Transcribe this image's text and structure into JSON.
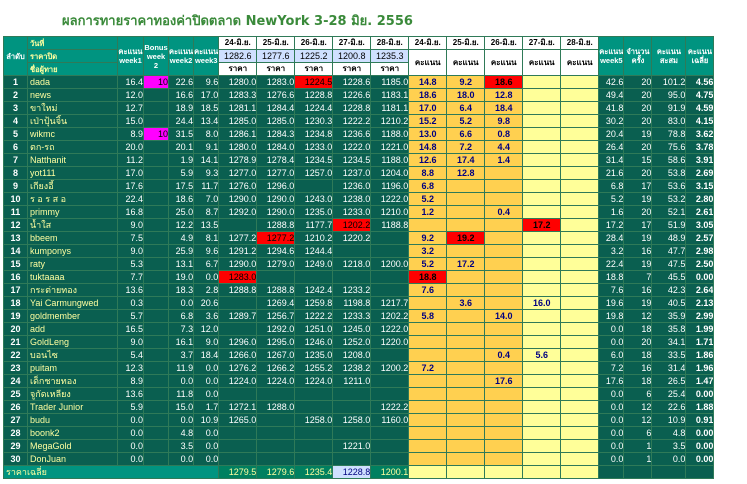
{
  "title": "ผลการทายราคาทองค่าปิดตลาด NewYork 3-28 มิย. 2556",
  "headers": {
    "rank": "ลำดับ",
    "date_label": "วันที่",
    "close_label": "ราคาปิด",
    "name_label": "ชื่อผู้ทาย",
    "week1": "คะแนน week1",
    "bonus": "Bonus week 2",
    "week2": "คะแนน week2",
    "week3": "คะแนน week3",
    "week5": "คะแนน week5",
    "total": "คะแนน สะสม",
    "count": "จำนวน ครั้ง",
    "avg": "คะแนน เฉลี่ย",
    "last": "คะแนน เฉลี่ย",
    "price_word": "ราคา",
    "score_word": "คะแนน",
    "average_label": "ราคาเฉลี่ย"
  },
  "dates": [
    "24-มิ.ย.",
    "25-มิ.ย.",
    "26-มิ.ย.",
    "27-มิ.ย.",
    "28-มิ.ย."
  ],
  "close_prices": [
    "1282.6",
    "1277.6",
    "1225.2",
    "1200.8",
    "1235.3"
  ],
  "average_prices": [
    "1279.5",
    "1279.6",
    "1235.4",
    "1228.8",
    "1200.1"
  ],
  "rows": [
    {
      "no": "1",
      "name": "dada",
      "w1": "16.4",
      "bonus": "10",
      "w2": "22.6",
      "w3": "9.6",
      "p": [
        "1280.0",
        "1283.0",
        "1224.5",
        "1228.6",
        "1185.0"
      ],
      "s": [
        "14.8",
        "9.2",
        "18.6",
        "",
        ""
      ],
      "w5": "42.6",
      "cnt": "20",
      "tot": "101.2",
      "avg": "4.56"
    },
    {
      "no": "2",
      "name": "news",
      "w1": "12.0",
      "bonus": "",
      "w2": "16.6",
      "w3": "17.0",
      "p": [
        "1283.3",
        "1276.6",
        "1228.8",
        "1226.6",
        "1183.1"
      ],
      "s": [
        "18.6",
        "18.0",
        "12.8",
        "",
        ""
      ],
      "w5": "49.4",
      "cnt": "20",
      "tot": "95.0",
      "avg": "4.75"
    },
    {
      "no": "3",
      "name": "ขาใหม่",
      "w1": "12.7",
      "bonus": "",
      "w2": "18.9",
      "w3": "18.5",
      "p": [
        "1281.1",
        "1284.4",
        "1224.4",
        "1228.8",
        "1181.1"
      ],
      "s": [
        "17.0",
        "6.4",
        "18.4",
        "",
        ""
      ],
      "w5": "41.8",
      "cnt": "20",
      "tot": "91.9",
      "avg": "4.59"
    },
    {
      "no": "4",
      "name": "เป่าปุ้นจิ้น",
      "w1": "15.0",
      "bonus": "",
      "w2": "24.4",
      "w3": "13.4",
      "p": [
        "1285.0",
        "1285.0",
        "1230.3",
        "1222.2",
        "1210.2"
      ],
      "s": [
        "15.2",
        "5.2",
        "9.8",
        "",
        ""
      ],
      "w5": "30.2",
      "cnt": "20",
      "tot": "83.0",
      "avg": "4.15"
    },
    {
      "no": "5",
      "name": "wikmc",
      "w1": "8.9",
      "bonus": "10",
      "w2": "31.5",
      "w3": "8.0",
      "p": [
        "1286.1",
        "1284.3",
        "1234.8",
        "1236.6",
        "1188.0"
      ],
      "s": [
        "13.0",
        "6.6",
        "0.8",
        "",
        ""
      ],
      "w5": "20.4",
      "cnt": "19",
      "tot": "78.8",
      "avg": "3.62"
    },
    {
      "no": "6",
      "name": "ตก-รถ",
      "w1": "20.0",
      "bonus": "",
      "w2": "20.1",
      "w3": "9.1",
      "p": [
        "1280.0",
        "1284.0",
        "1233.0",
        "1222.0",
        "1221.0"
      ],
      "s": [
        "14.8",
        "7.2",
        "4.4",
        "",
        ""
      ],
      "w5": "26.4",
      "cnt": "20",
      "tot": "75.6",
      "avg": "3.78"
    },
    {
      "no": "7",
      "name": "Natthanit",
      "w1": "11.2",
      "bonus": "",
      "w2": "1.9",
      "w3": "14.1",
      "p": [
        "1278.9",
        "1278.4",
        "1234.5",
        "1234.5",
        "1188.0"
      ],
      "s": [
        "12.6",
        "17.4",
        "1.4",
        "",
        ""
      ],
      "w5": "31.4",
      "cnt": "15",
      "tot": "58.6",
      "avg": "3.91"
    },
    {
      "no": "8",
      "name": "yot111",
      "w1": "17.0",
      "bonus": "",
      "w2": "5.9",
      "w3": "9.3",
      "p": [
        "1277.0",
        "1277.0",
        "1257.0",
        "1237.0",
        "1204.0"
      ],
      "s": [
        "8.8",
        "12.8",
        "",
        "",
        ""
      ],
      "w5": "21.6",
      "cnt": "20",
      "tot": "53.8",
      "avg": "2.69"
    },
    {
      "no": "9",
      "name": "เกียงอี้",
      "w1": "17.6",
      "bonus": "",
      "w2": "17.5",
      "w3": "11.7",
      "p": [
        "1276.0",
        "1296.0",
        "",
        "1236.0",
        "1196.0"
      ],
      "s": [
        "6.8",
        "",
        "",
        "",
        ""
      ],
      "w5": "6.8",
      "cnt": "17",
      "tot": "53.6",
      "avg": "3.15"
    },
    {
      "no": "10",
      "name": "ร อ ร ส อ",
      "w1": "22.4",
      "bonus": "",
      "w2": "18.6",
      "w3": "7.0",
      "p": [
        "1290.0",
        "1290.0",
        "1243.0",
        "1238.0",
        "1222.0"
      ],
      "s": [
        "5.2",
        "",
        "",
        "",
        ""
      ],
      "w5": "5.2",
      "cnt": "19",
      "tot": "53.2",
      "avg": "2.80"
    },
    {
      "no": "11",
      "name": "primmy",
      "w1": "16.8",
      "bonus": "",
      "w2": "25.0",
      "w3": "8.7",
      "p": [
        "1292.0",
        "1290.0",
        "1235.0",
        "1233.0",
        "1210.0"
      ],
      "s": [
        "1.2",
        "",
        "0.4",
        "",
        ""
      ],
      "w5": "1.6",
      "cnt": "20",
      "tot": "52.1",
      "avg": "2.61"
    },
    {
      "no": "12",
      "name": "น้ำใส",
      "w1": "9.0",
      "bonus": "",
      "w2": "12.2",
      "w3": "13.5",
      "p": [
        "",
        "1288.8",
        "1177.7",
        "1202.2",
        "1188.8"
      ],
      "s": [
        "",
        "",
        "",
        "17.2",
        ""
      ],
      "w5": "17.2",
      "cnt": "17",
      "tot": "51.9",
      "avg": "3.05"
    },
    {
      "no": "13",
      "name": "bbeem",
      "w1": "7.5",
      "bonus": "",
      "w2": "4.9",
      "w3": "8.1",
      "p": [
        "1277.2",
        "1277.2",
        "1210.2",
        "1220.2",
        ""
      ],
      "s": [
        "9.2",
        "19.2",
        "",
        "",
        ""
      ],
      "w5": "28.4",
      "cnt": "19",
      "tot": "48.9",
      "avg": "2.57"
    },
    {
      "no": "14",
      "name": "kumponys",
      "w1": "9.0",
      "bonus": "",
      "w2": "25.9",
      "w3": "9.6",
      "p": [
        "1291.2",
        "1294.6",
        "1244.4",
        "",
        "",
        ""
      ],
      "s": [
        "3.2",
        "",
        "",
        "",
        ""
      ],
      "w5": "3.2",
      "cnt": "16",
      "tot": "47.7",
      "avg": "2.98"
    },
    {
      "no": "15",
      "name": "raty",
      "w1": "5.3",
      "bonus": "",
      "w2": "13.1",
      "w3": "6.7",
      "p": [
        "1290.0",
        "1279.0",
        "1249.0",
        "1218.0",
        "1200.0"
      ],
      "s": [
        "5.2",
        "17.2",
        "",
        "",
        ""
      ],
      "w5": "22.4",
      "cnt": "19",
      "tot": "47.5",
      "avg": "2.50"
    },
    {
      "no": "16",
      "name": "tuktaaaa",
      "w1": "7.7",
      "bonus": "",
      "w2": "19.0",
      "w3": "0.0",
      "p": [
        "1283.0",
        "",
        "",
        "",
        "",
        ""
      ],
      "s": [
        "18.8",
        "",
        "",
        "",
        ""
      ],
      "w5": "18.8",
      "cnt": "7",
      "tot": "45.5",
      "avg": "0.00"
    },
    {
      "no": "17",
      "name": "กระต่ายทอง",
      "w1": "13.6",
      "bonus": "",
      "w2": "18.3",
      "w3": "2.8",
      "p": [
        "1288.8",
        "1288.8",
        "1242.4",
        "1233.2",
        ""
      ],
      "s": [
        "7.6",
        "",
        "",
        "",
        ""
      ],
      "w5": "7.6",
      "cnt": "16",
      "tot": "42.3",
      "avg": "2.64"
    },
    {
      "no": "18",
      "name": "Yai Carmungwed",
      "w1": "0.3",
      "bonus": "",
      "w2": "0.0",
      "w3": "20.6",
      "p": [
        "",
        "1269.4",
        "1259.8",
        "1198.8",
        "1217.7"
      ],
      "s": [
        "",
        "3.6",
        "",
        "16.0",
        ""
      ],
      "w5": "19.6",
      "cnt": "19",
      "tot": "40.5",
      "avg": "2.13"
    },
    {
      "no": "19",
      "name": "goldmember",
      "w1": "5.7",
      "bonus": "",
      "w2": "6.8",
      "w3": "3.6",
      "p": [
        "1289.7",
        "1256.7",
        "1222.2",
        "1233.3",
        "1202.2"
      ],
      "s": [
        "5.8",
        "",
        "14.0",
        "",
        ""
      ],
      "w5": "19.8",
      "cnt": "12",
      "tot": "35.9",
      "avg": "2.99"
    },
    {
      "no": "20",
      "name": "add",
      "w1": "16.5",
      "bonus": "",
      "w2": "7.3",
      "w3": "12.0",
      "p": [
        "",
        "1292.0",
        "1251.0",
        "1245.0",
        "1222.0"
      ],
      "s": [
        "",
        "",
        "",
        "",
        ""
      ],
      "w5": "0.0",
      "cnt": "18",
      "tot": "35.8",
      "avg": "1.99"
    },
    {
      "no": "21",
      "name": "GoldLeng",
      "w1": "9.0",
      "bonus": "",
      "w2": "16.1",
      "w3": "9.0",
      "p": [
        "1296.0",
        "1295.0",
        "1246.0",
        "1252.0",
        "1220.0"
      ],
      "s": [
        "",
        "",
        "",
        "",
        ""
      ],
      "w5": "0.0",
      "cnt": "20",
      "tot": "34.1",
      "avg": "1.71"
    },
    {
      "no": "22",
      "name": "บอนไซ",
      "w1": "5.4",
      "bonus": "",
      "w2": "3.7",
      "w3": "18.4",
      "p": [
        "1266.0",
        "1267.0",
        "1235.0",
        "1208.0",
        ""
      ],
      "s": [
        "",
        "",
        "0.4",
        "5.6",
        ""
      ],
      "w5": "6.0",
      "cnt": "18",
      "tot": "33.5",
      "avg": "1.86"
    },
    {
      "no": "23",
      "name": "puitam",
      "w1": "12.3",
      "bonus": "",
      "w2": "11.9",
      "w3": "0.0",
      "p": [
        "1276.2",
        "1266.2",
        "1255.2",
        "1238.2",
        "1200.2"
      ],
      "s": [
        "7.2",
        "",
        "",
        "",
        ""
      ],
      "w5": "7.2",
      "cnt": "16",
      "tot": "31.4",
      "avg": "1.96"
    },
    {
      "no": "24",
      "name": "เด็กชายทอง",
      "w1": "8.9",
      "bonus": "",
      "w2": "0.0",
      "w3": "0.0",
      "p": [
        "1224.0",
        "1224.0",
        "1224.0",
        "1211.0",
        ""
      ],
      "s": [
        "",
        "",
        "17.6",
        "",
        ""
      ],
      "w5": "17.6",
      "cnt": "18",
      "tot": "26.5",
      "avg": "1.47"
    },
    {
      "no": "25",
      "name": "จูกัดเหลียง",
      "w1": "13.6",
      "bonus": "",
      "w2": "11.8",
      "w3": "0.0",
      "p": [
        "",
        "",
        "",
        "",
        "",
        ""
      ],
      "s": [
        "",
        "",
        "",
        "",
        ""
      ],
      "w5": "0.0",
      "cnt": "6",
      "tot": "25.4",
      "avg": "0.00"
    },
    {
      "no": "26",
      "name": "Trader Junior",
      "w1": "5.9",
      "bonus": "",
      "w2": "15.0",
      "w3": "1.7",
      "p": [
        "1272.1",
        "1288.0",
        "",
        "",
        "1222.2"
      ],
      "s": [
        "",
        "",
        "",
        "",
        ""
      ],
      "w5": "0.0",
      "cnt": "12",
      "tot": "22.6",
      "avg": "1.88"
    },
    {
      "no": "27",
      "name": "budu",
      "w1": "0.0",
      "bonus": "",
      "w2": "0.0",
      "w3": "10.9",
      "p": [
        "1265.0",
        "",
        "1258.0",
        "1258.0",
        "1160.0"
      ],
      "s": [
        "",
        "",
        "",
        "",
        ""
      ],
      "w5": "0.0",
      "cnt": "12",
      "tot": "10.9",
      "avg": "0.91"
    },
    {
      "no": "28",
      "name": "boonk2",
      "w1": "0.0",
      "bonus": "",
      "w2": "4.8",
      "w3": "0.0",
      "p": [
        "",
        "",
        "",
        "",
        "",
        ""
      ],
      "s": [
        "",
        "",
        "",
        "",
        ""
      ],
      "w5": "0.0",
      "cnt": "6",
      "tot": "4.8",
      "avg": "0.00"
    },
    {
      "no": "29",
      "name": "MegaGold",
      "w1": "0.0",
      "bonus": "",
      "w2": "3.5",
      "w3": "0.0",
      "p": [
        "",
        "",
        "",
        "1221.0",
        ""
      ],
      "s": [
        "",
        "",
        "",
        "",
        ""
      ],
      "w5": "0.0",
      "cnt": "1",
      "tot": "3.5",
      "avg": "0.00"
    },
    {
      "no": "30",
      "name": "DonJuan",
      "w1": "0.0",
      "bonus": "",
      "w2": "0.0",
      "w3": "0.0",
      "p": [
        "",
        "",
        "",
        "",
        "",
        ""
      ],
      "s": [
        "",
        "",
        "",
        "",
        ""
      ],
      "w5": "0.0",
      "cnt": "1",
      "tot": "0.0",
      "avg": "0.00"
    }
  ],
  "highlights": {
    "red_prices": [
      [
        0,
        2
      ],
      [
        11,
        3
      ],
      [
        12,
        1
      ],
      [
        15,
        0
      ]
    ],
    "red_scores": [
      [
        0,
        2
      ],
      [
        11,
        3
      ],
      [
        12,
        1
      ],
      [
        15,
        0
      ]
    ],
    "magenta_bonus": [
      0,
      4
    ]
  },
  "colors": {
    "header_green": "#009480",
    "dark_green": "#0a5f50",
    "score_yellow": "#ffff99",
    "score_orange": "#ffd050",
    "highlight_red": "#ff0000",
    "bonus_magenta": "#ff00ff",
    "title_green": "#3a8a3a"
  }
}
